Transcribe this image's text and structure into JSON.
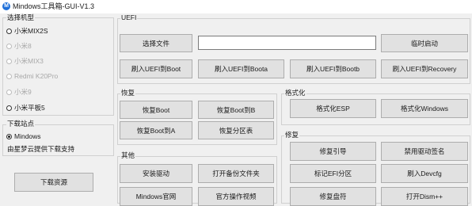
{
  "window": {
    "title": "Mindows工具箱-GUI-V1.3",
    "icon_letter": "M"
  },
  "model_group": {
    "title": "选择机型",
    "options": [
      {
        "label": "小米MIX2S",
        "checked": false,
        "enabled": true
      },
      {
        "label": "小米8",
        "checked": false,
        "enabled": false
      },
      {
        "label": "小米MIX3",
        "checked": false,
        "enabled": false
      },
      {
        "label": "Redmi K20Pro",
        "checked": false,
        "enabled": false
      },
      {
        "label": "小米9",
        "checked": false,
        "enabled": false
      },
      {
        "label": "小米平板5",
        "checked": false,
        "enabled": true
      }
    ]
  },
  "download_group": {
    "title": "下载站点",
    "option": {
      "label": "Mindows",
      "checked": true
    },
    "note": "由星梦云提供下载支持"
  },
  "download_button": "下载资源",
  "uefi_group": {
    "title": "UEFI",
    "select_file": "选择文件",
    "path_value": "",
    "temp_boot": "临时启动",
    "flash_buttons": [
      "刷入UEFI到Boot",
      "刷入UEFI到Boota",
      "刷入UEFI到Bootb",
      "刷入UEFI到Recovery"
    ]
  },
  "restore_group": {
    "title": "恢复",
    "buttons": [
      "恢复Boot",
      "恢复Boot到B",
      "恢复Boot到A",
      "恢复分区表"
    ]
  },
  "format_group": {
    "title": "格式化",
    "buttons": [
      "格式化ESP",
      "格式化Windows"
    ]
  },
  "other_group": {
    "title": "其他",
    "buttons": [
      "安装驱动",
      "打开备份文件夹",
      "Mindows官网",
      "官方操作视频"
    ]
  },
  "repair_group": {
    "title": "修复",
    "buttons": [
      "修复引导",
      "禁用驱动签名",
      "标记EFI分区",
      "刷入Devcfg",
      "修复盘符",
      "打开Dism++"
    ]
  }
}
